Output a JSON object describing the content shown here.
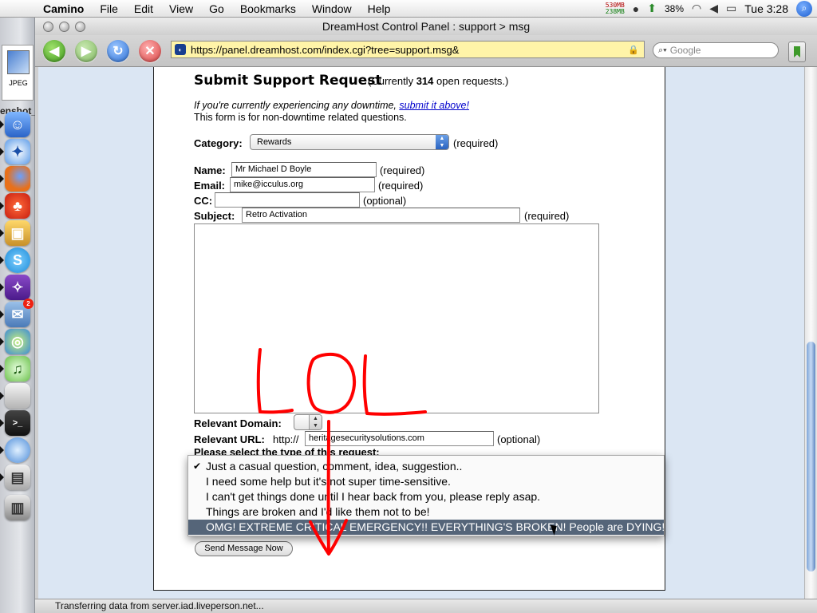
{
  "menubar": {
    "app": "Camino",
    "items": [
      "File",
      "Edit",
      "View",
      "Go",
      "Bookmarks",
      "Window",
      "Help"
    ],
    "mem_used": "530MB",
    "mem_free": "238MB",
    "battery": "38%",
    "clock": "Tue 3:28"
  },
  "dock": {
    "file_label": "JPEG",
    "label": "enshot_",
    "badge_count": "2"
  },
  "window": {
    "title": "DreamHost Control Panel : support > msg",
    "url": "https://panel.dreamhost.com/index.cgi?tree=support.msg&",
    "search_placeholder": "Google",
    "status": "Transferring data from server.iad.liveperson.net..."
  },
  "page": {
    "title": "Submit Support Request",
    "count_prefix": "(Currently",
    "count": "314",
    "count_suffix": "open requests.)",
    "downtime_text": "If you're currently experiencing any downtime,",
    "downtime_link": "submit it above!",
    "nondowntime": "This form is for non-downtime related questions.",
    "category_label": "Category:",
    "category_value": "Rewards",
    "required": "(required)",
    "optional": "(optional)",
    "name_label": "Name:",
    "name_value": "Mr Michael D Boyle",
    "email_label": "Email:",
    "email_value": "mike@icculus.org",
    "cc_label": "CC:",
    "cc_value": "",
    "subject_label": "Subject:",
    "subject_value": "Retro Activation",
    "domain_label": "Relevant Domain:",
    "url_label": "Relevant URL:",
    "url_prefix": "http://",
    "url_value": "heritagesecuritysolutions.com",
    "type_label": "Please select the type of this request:",
    "send_button": "Send Message Now"
  },
  "popup": {
    "options": [
      {
        "label": "Just a casual question, comment, idea, suggestion..",
        "checked": true
      },
      {
        "label": "I need some help but it's not super time-sensitive."
      },
      {
        "label": "I can't get things done until I hear back from you, please reply asap."
      },
      {
        "label": "Things are broken and I'd like them not to be!"
      },
      {
        "label": "OMG! EXTREME CRITICAL EMERGENCY!! EVERYTHING'S BROKEN! People are DYING!",
        "highlighted": true
      }
    ]
  },
  "annotation": {
    "text": "LOL",
    "color": "#ff0000"
  }
}
